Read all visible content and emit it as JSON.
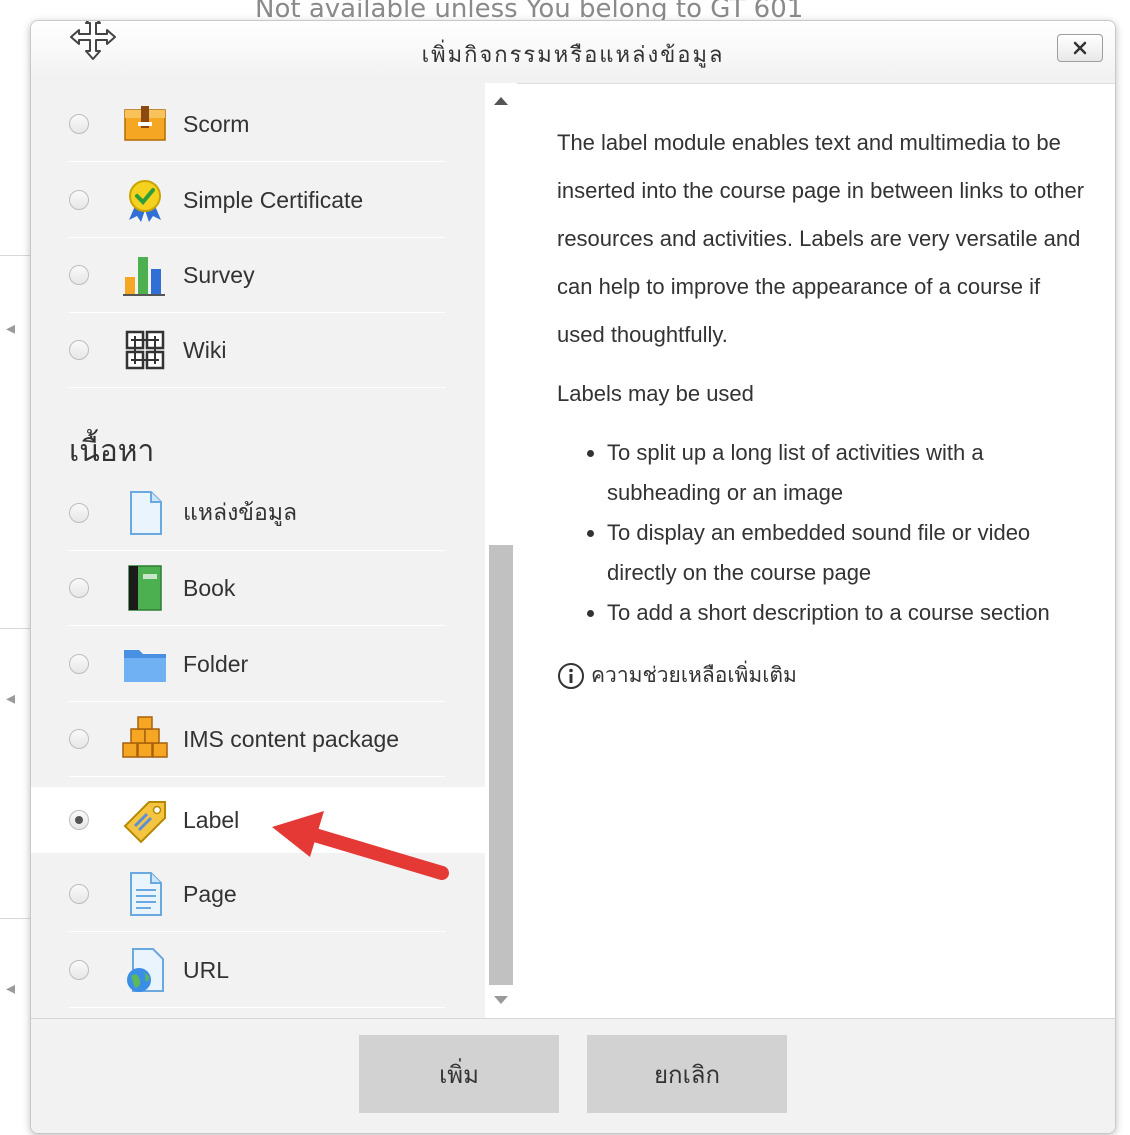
{
  "background": {
    "text": "Not available unless  You belong to GT 601"
  },
  "dialog": {
    "title": "เพิ่มกิจกรรมหรือแหล่งข้อมูล",
    "close_label": "✕"
  },
  "activities": [
    {
      "label": "Scorm",
      "icon": "package-box-icon"
    },
    {
      "label": "Simple Certificate",
      "icon": "certificate-ribbon-icon"
    },
    {
      "label": "Survey",
      "icon": "bar-chart-icon"
    },
    {
      "label": "Wiki",
      "icon": "wiki-puzzle-icon"
    }
  ],
  "resources_section": {
    "heading": "เนื้อหา",
    "items": [
      {
        "label": "แหล่งข้อมูล",
        "icon": "file-icon"
      },
      {
        "label": "Book",
        "icon": "book-icon"
      },
      {
        "label": "Folder",
        "icon": "folder-icon"
      },
      {
        "label": "IMS content package",
        "icon": "stacked-boxes-icon"
      },
      {
        "label": "Label",
        "icon": "tag-icon",
        "selected": true
      },
      {
        "label": "Page",
        "icon": "page-icon"
      },
      {
        "label": "URL",
        "icon": "globe-page-icon"
      }
    ]
  },
  "description": {
    "intro": "The label module enables text and multimedia to be inserted into the course page in between links to other resources and activities. Labels are very versatile and can help to improve the appearance of a course if used thoughtfully.",
    "uses_heading": "Labels may be used",
    "uses": [
      "To split up a long list of activities with a subheading or an image",
      "To display an embedded sound file or video directly on the course page",
      "To add a short description to a course section"
    ],
    "help_link": "ความช่วยเหลือเพิ่มเติม"
  },
  "footer": {
    "add_label": "เพิ่ม",
    "cancel_label": "ยกเลิก"
  },
  "colors": {
    "selected_row": "#ffffff",
    "pane_bg": "#f2f2f2",
    "annotation_arrow": "#e53935"
  }
}
